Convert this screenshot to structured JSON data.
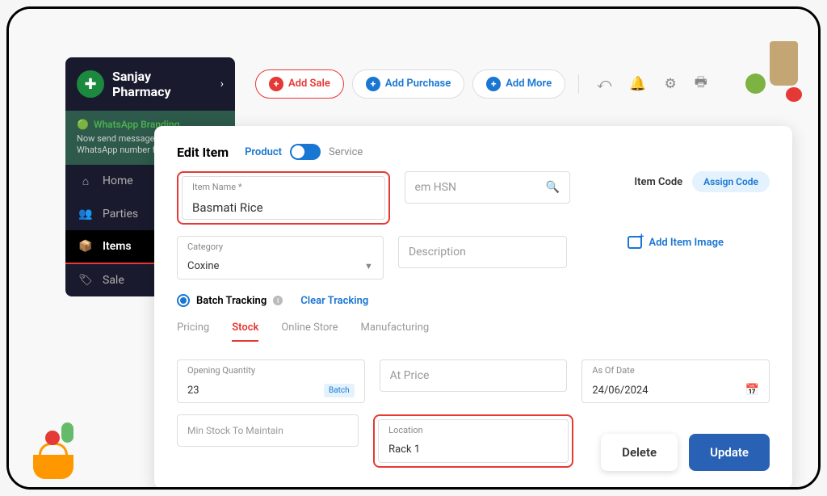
{
  "sidebar": {
    "title": "Sanjay Pharmacy",
    "promo_title": "WhatsApp Branding",
    "promo_text": "Now send messages with your own WhatsApp number free",
    "items": [
      {
        "icon": "⌂",
        "label": "Home"
      },
      {
        "icon": "👥",
        "label": "Parties"
      },
      {
        "icon": "📦",
        "label": "Items"
      },
      {
        "icon": "🏷",
        "label": "Sale"
      }
    ]
  },
  "topbar": {
    "add_sale": "Add Sale",
    "add_purchase": "Add Purchase",
    "add_more": "Add More"
  },
  "modal": {
    "title": "Edit Item",
    "type_product": "Product",
    "type_service": "Service",
    "item_name_label": "Item Name *",
    "item_name_value": "Basmati Rice",
    "hsn_placeholder": "em HSN",
    "item_code_label": "Item Code",
    "assign_code": "Assign Code",
    "category_label": "Category",
    "category_value": "Coxine",
    "description_placeholder": "Description",
    "add_image": "Add Item Image",
    "batch_tracking": "Batch Tracking",
    "clear_tracking": "Clear Tracking",
    "tabs": {
      "pricing": "Pricing",
      "stock": "Stock",
      "online": "Online Store",
      "manufacturing": "Manufacturing"
    },
    "opening_qty_label": "Opening Quantity",
    "opening_qty_value": "23",
    "batch_chip": "Batch",
    "at_price_label": "At Price",
    "as_of_date_label": "As Of Date",
    "as_of_date_value": "24/06/2024",
    "min_stock_label": "Min Stock To Maintain",
    "location_label": "Location",
    "location_value": "Rack 1",
    "delete_btn": "Delete",
    "update_btn": "Update"
  }
}
